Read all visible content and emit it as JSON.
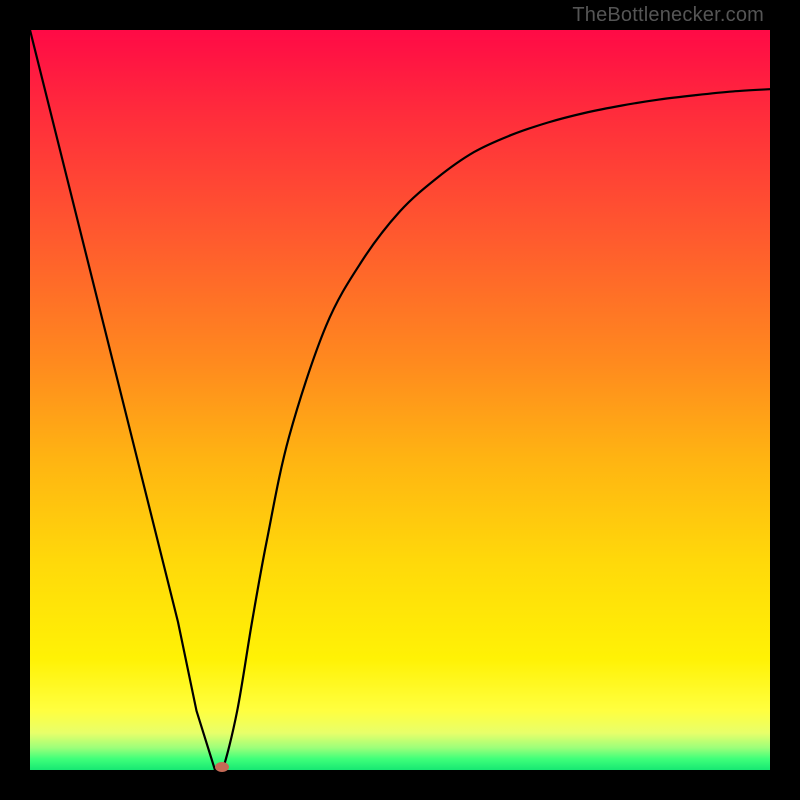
{
  "watermark": "TheBottlenecker.com",
  "colors": {
    "gradient_top": "#ff0a46",
    "gradient_bottom": "#17e873",
    "curve": "#000000",
    "marker": "#c46a56",
    "frame": "#000000"
  },
  "chart_data": {
    "type": "line",
    "title": "",
    "xlabel": "",
    "ylabel": "",
    "xlim": [
      0,
      100
    ],
    "ylim": [
      0,
      100
    ],
    "series": [
      {
        "name": "bottleneck-curve",
        "x": [
          0,
          5,
          10,
          15,
          20,
          22.5,
          25,
          26,
          28,
          30,
          32,
          35,
          40,
          45,
          50,
          55,
          60,
          65,
          70,
          75,
          80,
          85,
          90,
          95,
          100
        ],
        "y_percent_from_top": [
          0,
          20,
          40,
          60,
          80,
          92,
          100,
          100,
          92,
          80,
          69,
          55,
          40,
          31,
          24.5,
          20,
          16.5,
          14.2,
          12.5,
          11.2,
          10.2,
          9.4,
          8.8,
          8.3,
          8.0
        ]
      }
    ],
    "marker": {
      "x": 26,
      "y_percent_from_top": 100
    },
    "notes": "y is shown as distance from top (0=top, 100=bottom). Values estimated from pixels; chart has no axis ticks."
  }
}
